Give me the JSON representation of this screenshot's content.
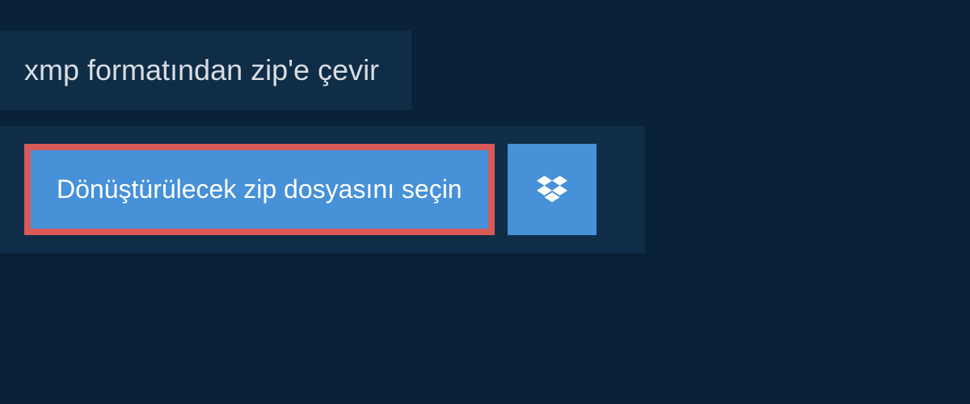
{
  "tab": {
    "title": "xmp formatından zip'e çevir"
  },
  "actions": {
    "select_file_label": "Dönüştürülecek zip dosyasını seçin"
  },
  "colors": {
    "background": "#0a2238",
    "panel": "#0f2d47",
    "button_primary": "#4691d8",
    "button_highlight_border": "#d95a57"
  }
}
